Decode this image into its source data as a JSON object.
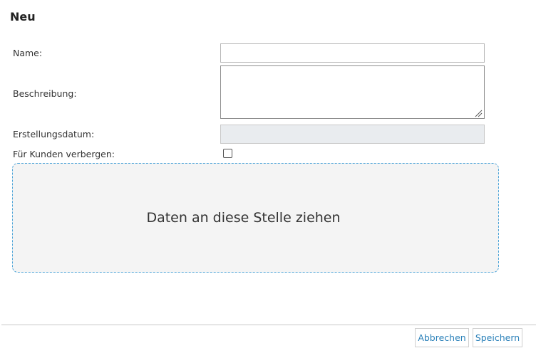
{
  "dialog": {
    "title": "Neu"
  },
  "form": {
    "name": {
      "label": "Name:",
      "value": ""
    },
    "description": {
      "label": "Beschreibung:",
      "value": ""
    },
    "creation_date": {
      "label": "Erstellungsdatum:",
      "value": ""
    },
    "hide_from_customers": {
      "label": "Für Kunden verbergen:",
      "checked": false
    }
  },
  "dropzone": {
    "text": "Daten an diese Stelle ziehen"
  },
  "footer": {
    "cancel_label": "Abbrechen",
    "save_label": "Speichern"
  },
  "colors": {
    "accent": "#2a80b9",
    "dropzone_border": "#4aa3d8",
    "dropzone_background": "#f4f4f4",
    "disabled_field": "#e9ecef"
  }
}
